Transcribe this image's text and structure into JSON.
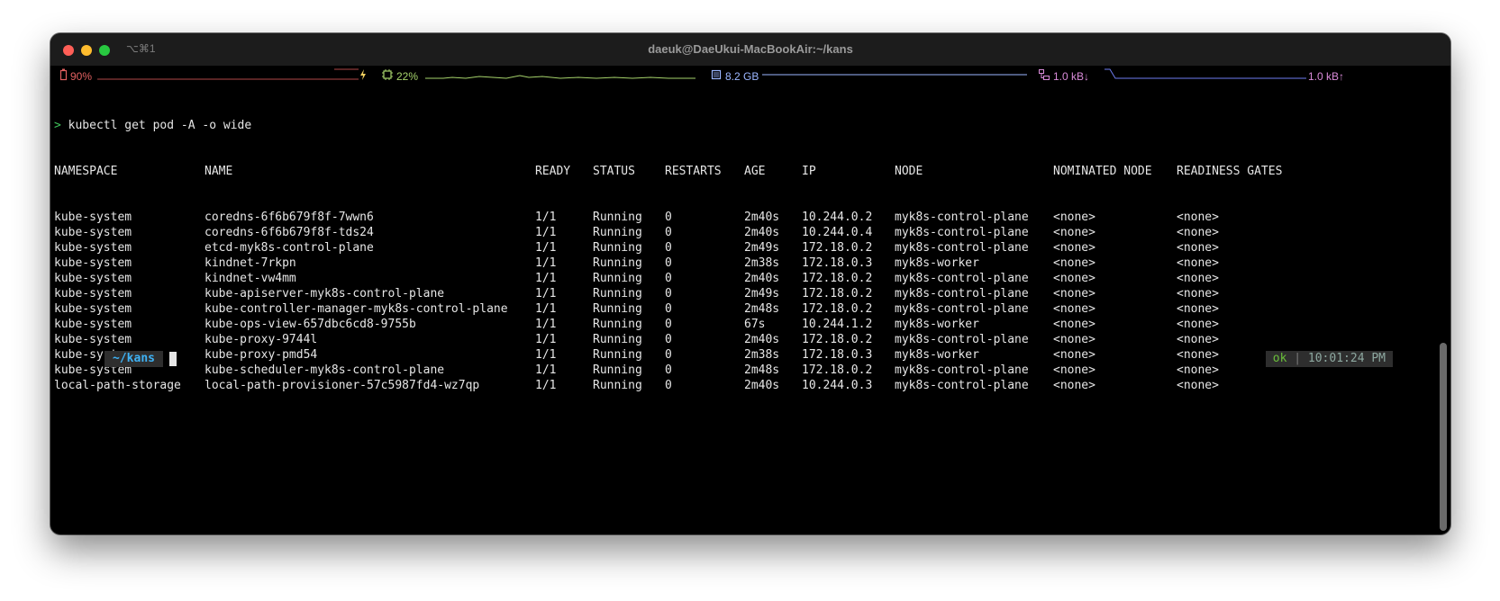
{
  "window": {
    "title": "daeuk@DaeUkui-MacBookAir:~/kans",
    "tab_shortcut": "⌥⌘1"
  },
  "statusbar": {
    "battery": "90%",
    "cpu": "22%",
    "memory": "8.2 GB",
    "net_down": "1.0 kB↓",
    "net_up": "1.0 kB↑",
    "colors": {
      "battery": "#e06060",
      "cpu": "#a6d36b",
      "memory": "#9bb6ff",
      "network": "#d98bd9"
    }
  },
  "terminal": {
    "command": "kubectl get pod -A -o wide",
    "prompt_symbol": ">",
    "headers": [
      "NAMESPACE",
      "NAME",
      "READY",
      "STATUS",
      "RESTARTS",
      "AGE",
      "IP",
      "NODE",
      "NOMINATED NODE",
      "READINESS GATES"
    ],
    "rows": [
      [
        "kube-system",
        "coredns-6f6b679f8f-7wwn6",
        "1/1",
        "Running",
        "0",
        "2m40s",
        "10.244.0.2",
        "myk8s-control-plane",
        "<none>",
        "<none>"
      ],
      [
        "kube-system",
        "coredns-6f6b679f8f-tds24",
        "1/1",
        "Running",
        "0",
        "2m40s",
        "10.244.0.4",
        "myk8s-control-plane",
        "<none>",
        "<none>"
      ],
      [
        "kube-system",
        "etcd-myk8s-control-plane",
        "1/1",
        "Running",
        "0",
        "2m49s",
        "172.18.0.2",
        "myk8s-control-plane",
        "<none>",
        "<none>"
      ],
      [
        "kube-system",
        "kindnet-7rkpn",
        "1/1",
        "Running",
        "0",
        "2m38s",
        "172.18.0.3",
        "myk8s-worker",
        "<none>",
        "<none>"
      ],
      [
        "kube-system",
        "kindnet-vw4mm",
        "1/1",
        "Running",
        "0",
        "2m40s",
        "172.18.0.2",
        "myk8s-control-plane",
        "<none>",
        "<none>"
      ],
      [
        "kube-system",
        "kube-apiserver-myk8s-control-plane",
        "1/1",
        "Running",
        "0",
        "2m49s",
        "172.18.0.2",
        "myk8s-control-plane",
        "<none>",
        "<none>"
      ],
      [
        "kube-system",
        "kube-controller-manager-myk8s-control-plane",
        "1/1",
        "Running",
        "0",
        "2m48s",
        "172.18.0.2",
        "myk8s-control-plane",
        "<none>",
        "<none>"
      ],
      [
        "kube-system",
        "kube-ops-view-657dbc6cd8-9755b",
        "1/1",
        "Running",
        "0",
        "67s",
        "10.244.1.2",
        "myk8s-worker",
        "<none>",
        "<none>"
      ],
      [
        "kube-system",
        "kube-proxy-9744l",
        "1/1",
        "Running",
        "0",
        "2m40s",
        "172.18.0.2",
        "myk8s-control-plane",
        "<none>",
        "<none>"
      ],
      [
        "kube-system",
        "kube-proxy-pmd54",
        "1/1",
        "Running",
        "0",
        "2m38s",
        "172.18.0.3",
        "myk8s-worker",
        "<none>",
        "<none>"
      ],
      [
        "kube-system",
        "kube-scheduler-myk8s-control-plane",
        "1/1",
        "Running",
        "0",
        "2m48s",
        "172.18.0.2",
        "myk8s-control-plane",
        "<none>",
        "<none>"
      ],
      [
        "local-path-storage",
        "local-path-provisioner-57c5987fd4-wz7qp",
        "1/1",
        "Running",
        "0",
        "2m40s",
        "10.244.0.3",
        "myk8s-control-plane",
        "<none>",
        "<none>"
      ]
    ],
    "cwd": "~/kans",
    "status": "ok",
    "status_separator": "|",
    "time": "10:01:24 PM"
  }
}
